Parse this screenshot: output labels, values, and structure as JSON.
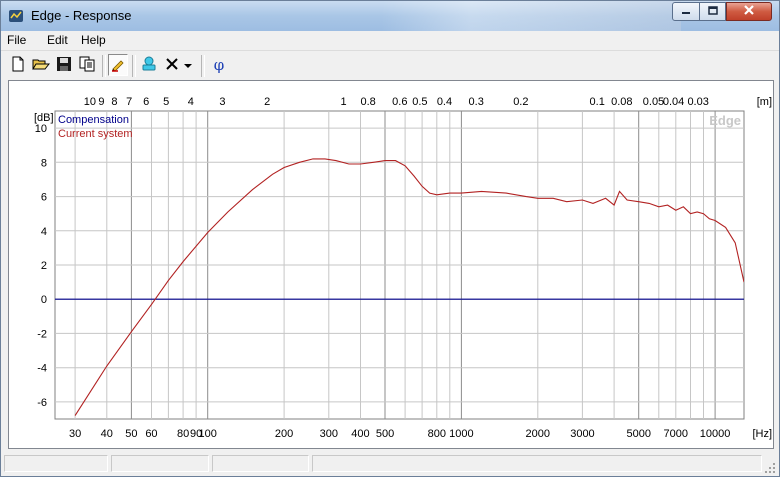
{
  "window": {
    "title": "Edge - Response",
    "app_icon": "speaker-icon",
    "controls": [
      "minimize-icon",
      "maximize-icon",
      "close-icon"
    ]
  },
  "menu": {
    "items": [
      "File",
      "Edit",
      "Help"
    ]
  },
  "toolbar": {
    "buttons": [
      {
        "name": "new-button",
        "icon": "new-document-icon"
      },
      {
        "name": "open-button",
        "icon": "folder-open-icon"
      },
      {
        "name": "save-button",
        "icon": "floppy-disk-icon"
      },
      {
        "name": "copy-button",
        "icon": "copy-icon"
      },
      {
        "name": "draw-button",
        "icon": "pencil-icon",
        "pressed": true
      },
      {
        "name": "stamp-button",
        "icon": "stamp-icon"
      },
      {
        "name": "delete-button",
        "icon": "x-icon"
      },
      {
        "name": "delete-dropdown-button",
        "icon": "dropdown-arrow-icon"
      },
      {
        "name": "phase-button",
        "icon": "phi-icon",
        "label": "φ"
      }
    ]
  },
  "chart_data": {
    "type": "line",
    "watermark": "Edge",
    "x_scale": "log",
    "xlim": [
      25,
      13000
    ],
    "ylim": [
      -7,
      11
    ],
    "x_unit_label": "[Hz]",
    "y_unit_label": "[dB]",
    "top_unit_label": "[m]",
    "x_ticks": [
      {
        "v": 30,
        "label": "30"
      },
      {
        "v": 40,
        "label": "40"
      },
      {
        "v": 50,
        "label": "50"
      },
      {
        "v": 60,
        "label": "60"
      },
      {
        "v": 80,
        "label": "80"
      },
      {
        "v": 90,
        "label": "90"
      },
      {
        "v": 100,
        "label": "100"
      },
      {
        "v": 200,
        "label": "200"
      },
      {
        "v": 300,
        "label": "300"
      },
      {
        "v": 400,
        "label": "400"
      },
      {
        "v": 500,
        "label": "500"
      },
      {
        "v": 800,
        "label": "800"
      },
      {
        "v": 1000,
        "label": "1000"
      },
      {
        "v": 2000,
        "label": "2000"
      },
      {
        "v": 3000,
        "label": "3000"
      },
      {
        "v": 5000,
        "label": "5000"
      },
      {
        "v": 7000,
        "label": "7000"
      },
      {
        "v": 10000,
        "label": "10000"
      }
    ],
    "x_gridlines": [
      30,
      40,
      50,
      60,
      70,
      80,
      90,
      100,
      200,
      300,
      400,
      500,
      600,
      700,
      800,
      900,
      1000,
      2000,
      3000,
      4000,
      5000,
      6000,
      7000,
      8000,
      9000,
      10000
    ],
    "x_major_gridlines": [
      50,
      100,
      500,
      1000,
      5000,
      10000
    ],
    "top_ticks": [
      {
        "hz": 34.3,
        "label": "10"
      },
      {
        "hz": 38.1,
        "label": "9"
      },
      {
        "hz": 42.9,
        "label": "8"
      },
      {
        "hz": 49,
        "label": "7"
      },
      {
        "hz": 57.2,
        "label": "6"
      },
      {
        "hz": 68.6,
        "label": "5"
      },
      {
        "hz": 85.8,
        "label": "4"
      },
      {
        "hz": 114.3,
        "label": "3"
      },
      {
        "hz": 171.5,
        "label": "2"
      },
      {
        "hz": 343,
        "label": "1"
      },
      {
        "hz": 428.8,
        "label": "0.8"
      },
      {
        "hz": 571.7,
        "label": "0.6"
      },
      {
        "hz": 686,
        "label": "0.5"
      },
      {
        "hz": 857.5,
        "label": "0.4"
      },
      {
        "hz": 1143.3,
        "label": "0.3"
      },
      {
        "hz": 1715,
        "label": "0.2"
      },
      {
        "hz": 3430,
        "label": "0.1"
      },
      {
        "hz": 4287.5,
        "label": "0.08"
      },
      {
        "hz": 5716.7,
        "label": "0.05"
      },
      {
        "hz": 6860,
        "label": "0.04"
      },
      {
        "hz": 8575,
        "label": "0.03"
      }
    ],
    "y_ticks": [
      {
        "v": 10,
        "label": "10"
      },
      {
        "v": 8,
        "label": "8"
      },
      {
        "v": 6,
        "label": "6"
      },
      {
        "v": 4,
        "label": "4"
      },
      {
        "v": 2,
        "label": "2"
      },
      {
        "v": 0,
        "label": "0"
      },
      {
        "v": -2,
        "label": "-2"
      },
      {
        "v": -4,
        "label": "-4"
      },
      {
        "v": -6,
        "label": "-6"
      }
    ],
    "series": [
      {
        "name": "Compensation",
        "color": "#00008b",
        "x": [
          25,
          13000
        ],
        "y": [
          0,
          0
        ]
      },
      {
        "name": "Current system",
        "color": "#b22222",
        "x": [
          30,
          40,
          50,
          60,
          70,
          80,
          100,
          120,
          150,
          180,
          200,
          230,
          260,
          290,
          320,
          360,
          400,
          450,
          500,
          550,
          600,
          650,
          700,
          750,
          800,
          900,
          1000,
          1200,
          1500,
          1800,
          2000,
          2300,
          2600,
          3000,
          3300,
          3700,
          4000,
          4200,
          4500,
          5000,
          5500,
          6000,
          6500,
          7000,
          7500,
          8000,
          8500,
          9000,
          9500,
          10000,
          11000,
          12000,
          13000
        ],
        "y": [
          -6.8,
          -3.9,
          -1.9,
          -0.3,
          1.1,
          2.2,
          3.9,
          5.1,
          6.4,
          7.3,
          7.7,
          8.0,
          8.2,
          8.2,
          8.1,
          7.9,
          7.9,
          8.0,
          8.1,
          8.1,
          7.8,
          7.2,
          6.6,
          6.2,
          6.1,
          6.2,
          6.2,
          6.3,
          6.2,
          6.0,
          5.9,
          5.9,
          5.7,
          5.8,
          5.6,
          5.9,
          5.5,
          6.3,
          5.8,
          5.7,
          5.6,
          5.4,
          5.5,
          5.2,
          5.4,
          5.0,
          5.1,
          5.0,
          4.7,
          4.6,
          4.2,
          3.3,
          1.0
        ]
      }
    ]
  },
  "statusbar": {
    "panels": [
      "",
      "",
      "",
      ""
    ]
  }
}
